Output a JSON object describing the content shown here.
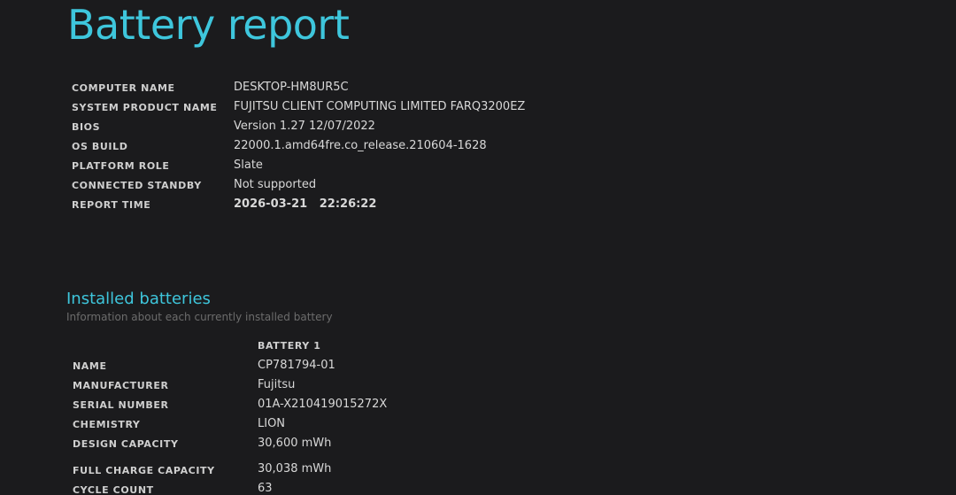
{
  "title": "Battery report",
  "system_info": [
    {
      "label": "COMPUTER NAME",
      "value": "DESKTOP-HM8UR5C"
    },
    {
      "label": "SYSTEM PRODUCT NAME",
      "value": "FUJITSU CLIENT COMPUTING LIMITED FARQ3200EZ"
    },
    {
      "label": "BIOS",
      "value": "Version 1.27 12/07/2022"
    },
    {
      "label": "OS BUILD",
      "value": "22000.1.amd64fre.co_release.210604-1628"
    },
    {
      "label": "PLATFORM ROLE",
      "value": "Slate"
    },
    {
      "label": "CONNECTED STANDBY",
      "value": "Not supported"
    },
    {
      "label": "REPORT TIME",
      "value": "2026-03-21   22:26:22"
    }
  ],
  "installed_batteries": {
    "title": "Installed batteries",
    "subtitle": "Information about each currently installed battery",
    "column_header": "BATTERY 1",
    "rows": [
      {
        "label": "NAME",
        "value": "CP781794-01"
      },
      {
        "label": "MANUFACTURER",
        "value": "Fujitsu"
      },
      {
        "label": "SERIAL NUMBER",
        "value": "01A-X210419015272X"
      },
      {
        "label": "CHEMISTRY",
        "value": "LION"
      },
      {
        "label": "DESIGN CAPACITY",
        "value": "30,600 mWh"
      },
      {
        "label": "FULL CHARGE CAPACITY",
        "value": "30,038 mWh"
      },
      {
        "label": "CYCLE COUNT",
        "value": "63"
      }
    ]
  }
}
